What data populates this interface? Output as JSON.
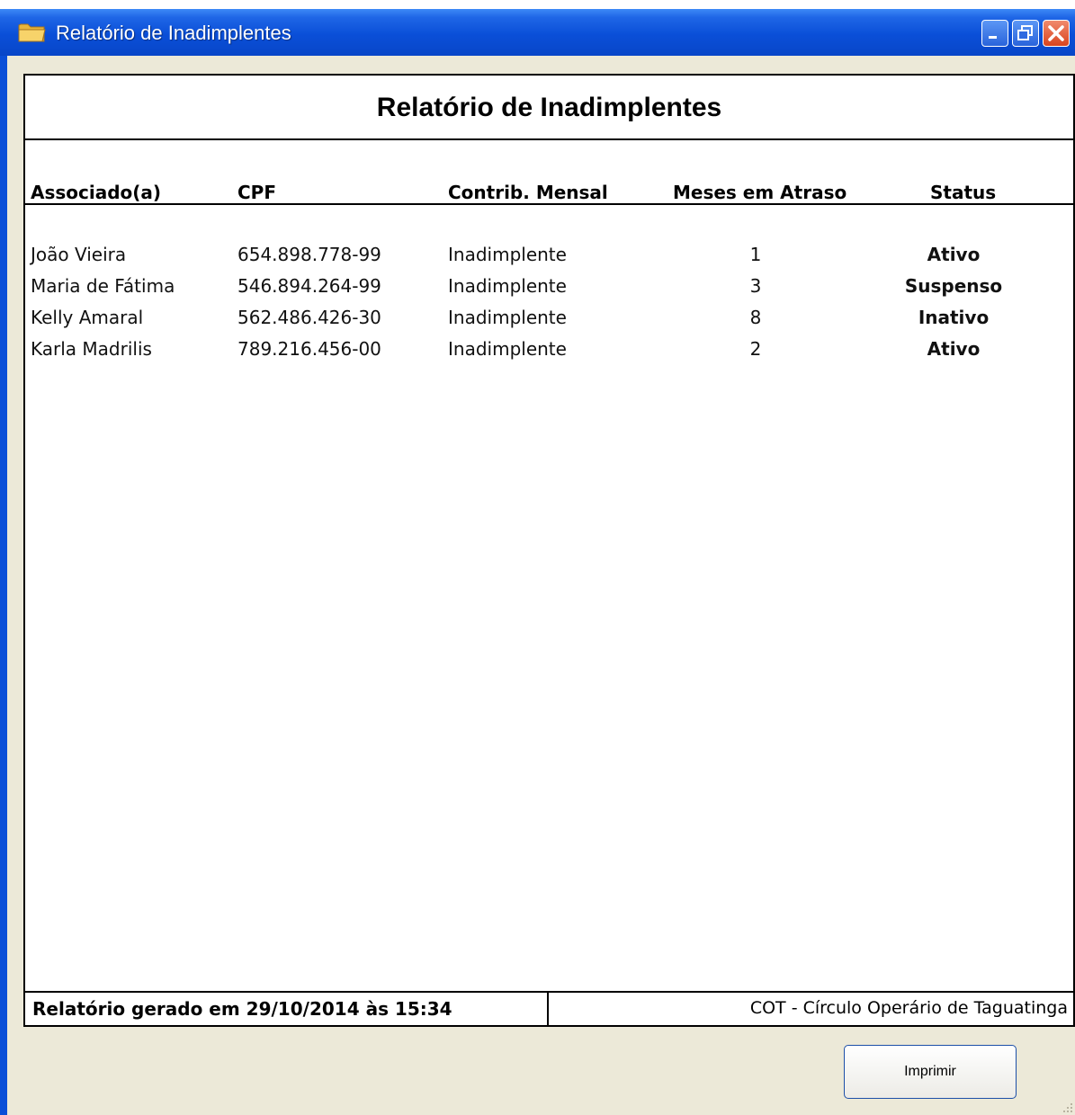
{
  "window": {
    "title": "Relatório de Inadimplentes"
  },
  "report": {
    "title": "Relatório de Inadimplentes",
    "columns": [
      "Associado(a)",
      "CPF",
      "Contrib. Mensal",
      "Meses em Atraso",
      "Status"
    ],
    "rows": [
      {
        "name": "João Vieira",
        "cpf": "654.898.778-99",
        "contrib": "Inadimplente",
        "months": "1",
        "status": "Ativo"
      },
      {
        "name": "Maria de Fátima",
        "cpf": "546.894.264-99",
        "contrib": "Inadimplente",
        "months": "3",
        "status": "Suspenso"
      },
      {
        "name": "Kelly Amaral",
        "cpf": "562.486.426-30",
        "contrib": "Inadimplente",
        "months": "8",
        "status": "Inativo"
      },
      {
        "name": "Karla Madrilis",
        "cpf": "789.216.456-00",
        "contrib": "Inadimplente",
        "months": "2",
        "status": "Ativo"
      }
    ],
    "footer_left": "Relatório gerado em 29/10/2014 às 15:34",
    "footer_right": "COT - Círculo Operário de Taguatinga"
  },
  "buttons": {
    "print": "Imprimir"
  },
  "icons": {
    "window": "folder-icon",
    "minimize": "minimize-icon",
    "maximize": "restore-icon",
    "close": "close-icon"
  },
  "colors": {
    "titlebar": "#0a4fd8",
    "client_bg": "#ece9d8",
    "close_button": "#d9441f"
  }
}
